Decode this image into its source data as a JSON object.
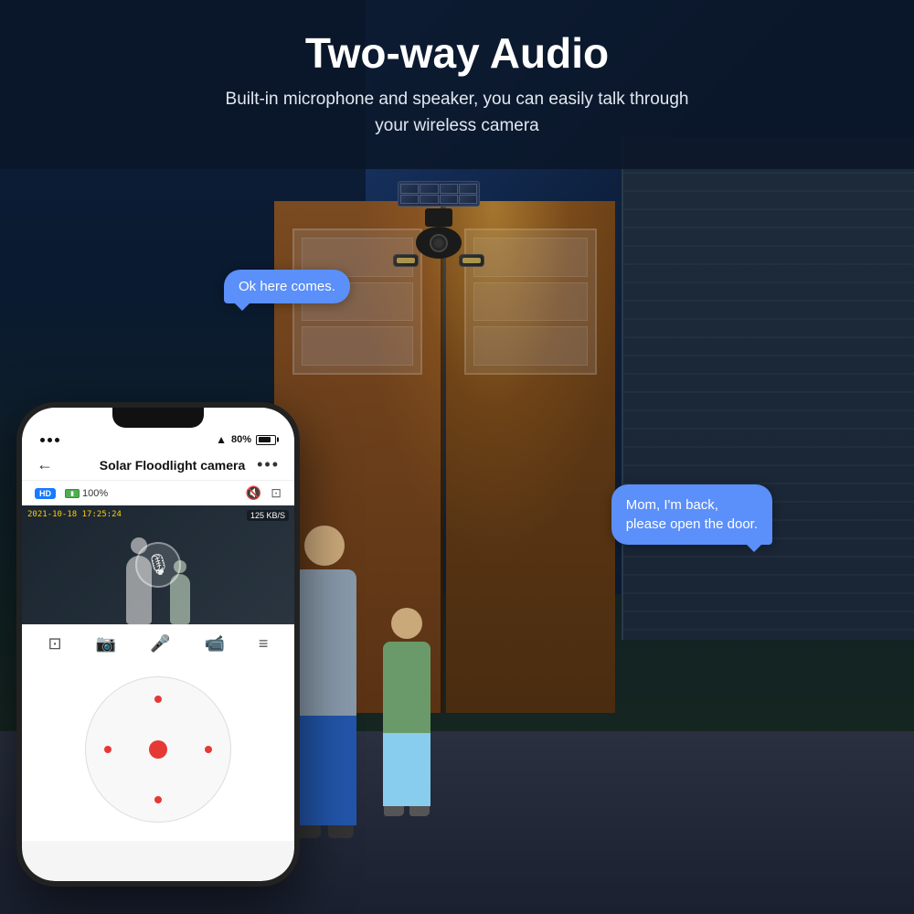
{
  "header": {
    "title": "Two-way Audio",
    "subtitle_line1": "Built-in microphone and speaker, you can easily talk through",
    "subtitle_line2": "your wireless camera"
  },
  "bubble_left": {
    "text": "Ok here comes."
  },
  "bubble_right": {
    "text": "Mom, I'm back,\nplease open the door."
  },
  "phone": {
    "status": {
      "battery_pct": "80%",
      "wifi_symbol": "wifi"
    },
    "nav": {
      "back_label": "←",
      "title": "Solar Floodlight camera",
      "menu_label": "•••"
    },
    "controls": {
      "hd_label": "HD",
      "battery_label": "100%",
      "mute_icon": "🔇",
      "fullscreen_icon": "⊡"
    },
    "video": {
      "timestamp": "2021-10-18 17:25:24",
      "kbps": "125 KB/S"
    },
    "toolbar": {
      "frame_icon": "⊡",
      "camera_icon": "📷",
      "mic_icon": "🎤",
      "video_icon": "🎬",
      "settings_icon": "≡"
    }
  }
}
